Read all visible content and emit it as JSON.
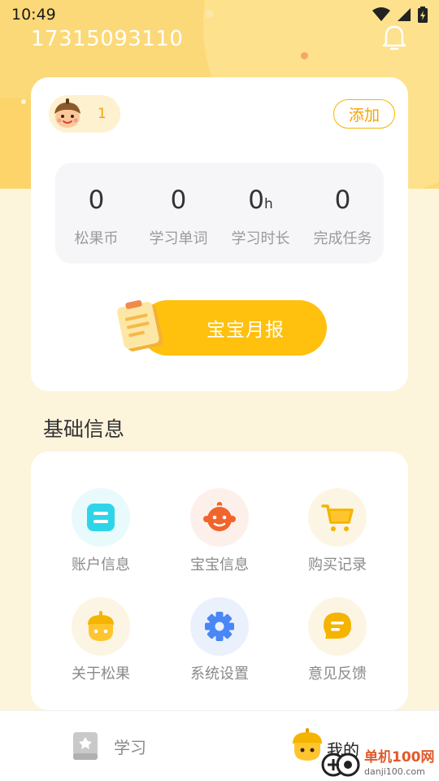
{
  "status_bar": {
    "time": "10:49"
  },
  "profile": {
    "phone": "17315093110",
    "acorn_count": "1",
    "add_label": "添加"
  },
  "stats": [
    {
      "value": "0",
      "unit": "",
      "label": "松果币"
    },
    {
      "value": "0",
      "unit": "",
      "label": "学习单词"
    },
    {
      "value": "0",
      "unit": "h",
      "label": "学习时长"
    },
    {
      "value": "0",
      "unit": "",
      "label": "完成任务"
    }
  ],
  "report": {
    "label": "宝宝月报"
  },
  "basic_info": {
    "title": "基础信息",
    "items": [
      {
        "label": "账户信息",
        "icon": "account-card-icon"
      },
      {
        "label": "宝宝信息",
        "icon": "baby-face-icon"
      },
      {
        "label": "购买记录",
        "icon": "shopping-cart-icon"
      },
      {
        "label": "关于松果",
        "icon": "acorn-icon"
      },
      {
        "label": "系统设置",
        "icon": "gear-icon"
      },
      {
        "label": "意见反馈",
        "icon": "feedback-bubble-icon"
      }
    ]
  },
  "bottom_nav": {
    "study": "学习",
    "mine": "我的"
  },
  "watermark": {
    "cn": "单机100网",
    "en": "danji100.com"
  },
  "colors": {
    "header": "#fcd978",
    "accent": "#ffc00e",
    "accent_text": "#f5a300",
    "page_bg": "#fdf4dc",
    "cyan": "#2ed5e8",
    "orange": "#f0652b",
    "blue": "#4a86f5"
  }
}
